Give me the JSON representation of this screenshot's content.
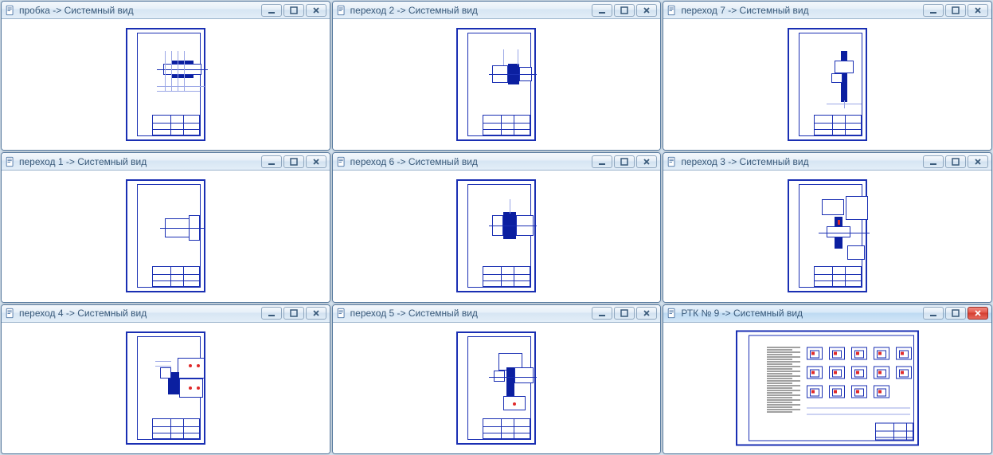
{
  "system_view_suffix": " -> Системный вид",
  "windows": [
    {
      "title": "пробка",
      "active": false,
      "orient": "portrait",
      "variant": "probka"
    },
    {
      "title": "переход 2",
      "active": false,
      "orient": "portrait",
      "variant": "step2"
    },
    {
      "title": "переход 7",
      "active": false,
      "orient": "portrait",
      "variant": "step7"
    },
    {
      "title": "переход 1",
      "active": false,
      "orient": "portrait",
      "variant": "step1"
    },
    {
      "title": "переход 6",
      "active": false,
      "orient": "portrait",
      "variant": "step6"
    },
    {
      "title": "переход 3",
      "active": false,
      "orient": "portrait",
      "variant": "step3"
    },
    {
      "title": "переход 4",
      "active": false,
      "orient": "portrait",
      "variant": "step4"
    },
    {
      "title": "переход 5",
      "active": false,
      "orient": "portrait",
      "variant": "step5"
    },
    {
      "title": "РТК № 9",
      "active": true,
      "orient": "landscape",
      "variant": "rtk"
    }
  ],
  "buttons": {
    "minimize": "minimize",
    "maximize": "maximize",
    "close": "close"
  }
}
